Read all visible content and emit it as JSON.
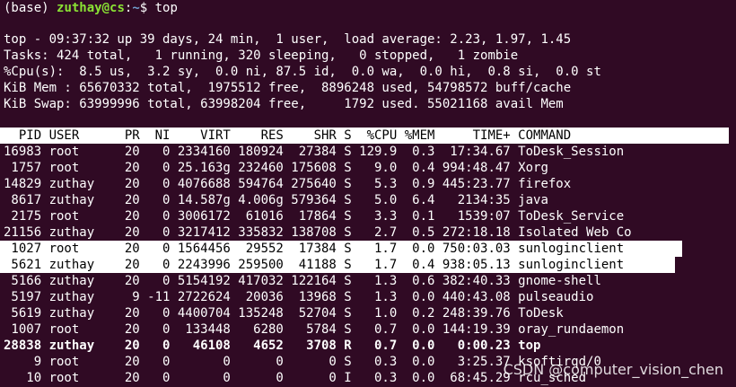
{
  "colors": {
    "background": "#300a24",
    "text": "#ffffff",
    "prompt_user": "#8ae234",
    "prompt_path": "#729fcf",
    "highlight_bg": "#ffffff",
    "highlight_text": "#000000"
  },
  "prompt": {
    "env": "(base) ",
    "userhost": "zuthay@cs",
    "sep": ":",
    "path": "~",
    "dollar": "$ ",
    "command": "top"
  },
  "summary": {
    "line1": "top - 09:37:32 up 39 days, 24 min,  1 user,  load average: 2.23, 1.97, 1.45",
    "line2": "Tasks: 424 total,   1 running, 320 sleeping,   0 stopped,   1 zombie",
    "line3": "%Cpu(s):  8.5 us,  3.2 sy,  0.0 ni, 87.5 id,  0.0 wa,  0.0 hi,  0.8 si,  0.0 st",
    "line4": "KiB Mem : 65670332 total,  1975512 free,  8896248 used, 54798572 buff/cache",
    "line5": "KiB Swap: 63999996 total, 63998204 free,     1792 used. 55021168 avail Mem"
  },
  "table_header": "  PID USER      PR  NI    VIRT    RES    SHR S  %CPU %MEM     TIME+ COMMAND",
  "processes": [
    "16983 root      20   0 2334160 180924  27384 S 129.9  0.3  17:34.67 ToDesk_Session",
    " 1757 root      20   0 25.163g 232460 175608 S   9.0  0.4 994:48.47 Xorg",
    "14829 zuthay    20   0 4076688 594764 275640 S   5.3  0.9 445:23.77 firefox",
    " 8617 zuthay    20   0 14.587g 4.006g 579364 S   5.0  6.4   2134:35 java",
    " 2175 root      20   0 3006172  61016  17864 S   3.3  0.1   1539:07 ToDesk_Service",
    "21156 zuthay    20   0 3217412 335832 138708 S   2.7  0.5 272:18.18 Isolated Web Co",
    " 1027 root      20   0 1564456  29552  17384 S   1.7  0.0 750:03.03 sunloginclient",
    " 5621 zuthay    20   0 2243996 259500  41188 S   1.7  0.4 938:05.13 sunloginclient",
    " 5166 zuthay    20   0 5154192 417032 122164 S   1.3  0.6 382:40.33 gnome-shell",
    " 5197 zuthay     9 -11 2722624  20036  13968 S   1.3  0.0 440:43.08 pulseaudio",
    " 5619 zuthay    20   0 4400704 135248  52704 S   1.0  0.2 248:39.76 ToDesk",
    " 1007 root      20   0  133448   6280   5784 S   0.7  0.0 144:19.39 oray_rundaemon",
    "28838 zuthay    20   0   46108   4652   3708 R   0.7  0.0   0:00.23 top",
    "    9 root      20   0       0      0      0 S   0.3  0.0   3:25.37 ksoftirqd/0",
    "   10 root      20   0       0      0      0 I   0.3  0.0  68:45.29 rcu_sched"
  ],
  "watermark": "CSDN @computer_vision_chen"
}
